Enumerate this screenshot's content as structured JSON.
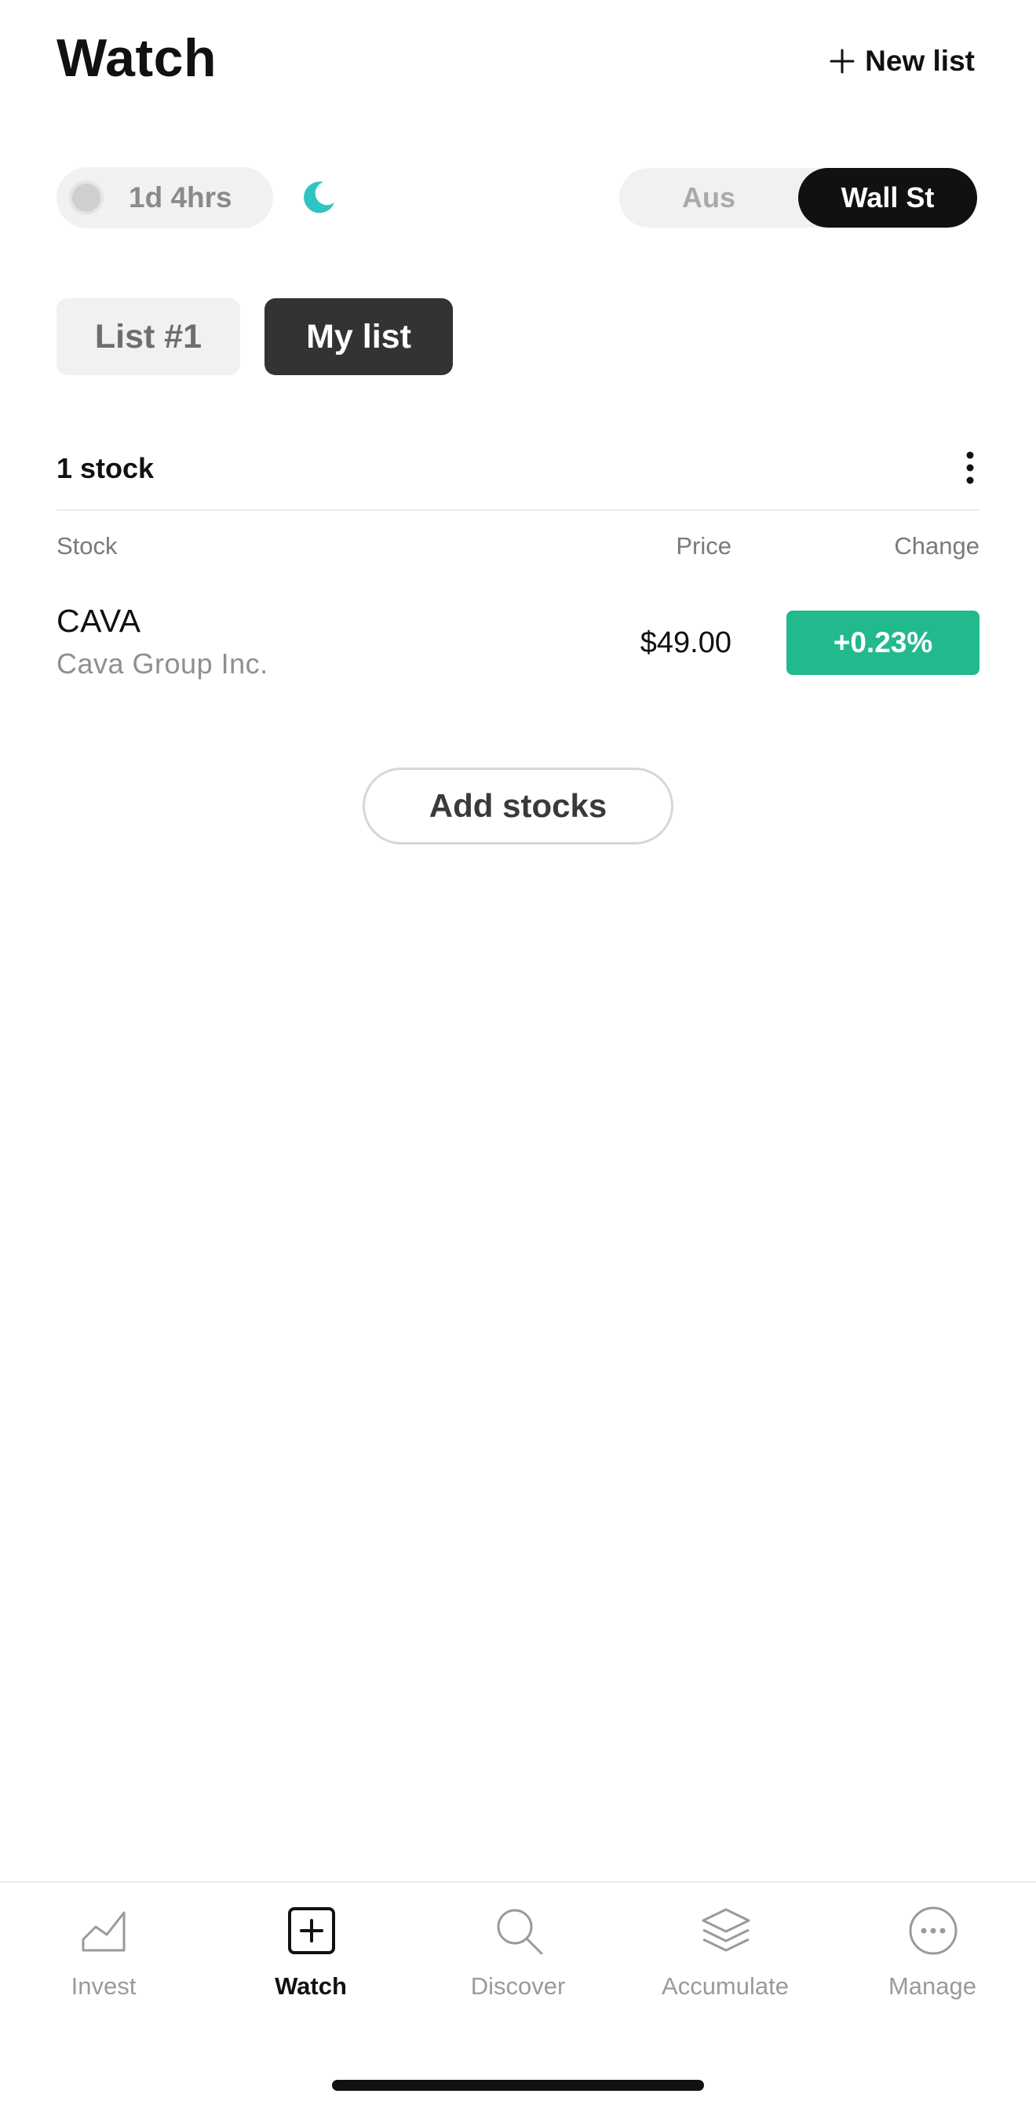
{
  "header": {
    "title": "Watch",
    "new_list_label": "New list"
  },
  "market_status": {
    "countdown": "1d 4hrs",
    "night_icon": "moon-icon",
    "moon_color": "#2fc4c4"
  },
  "market_toggle": {
    "options": [
      "Aus",
      "Wall St"
    ],
    "selected": "Wall St"
  },
  "lists": {
    "tabs": [
      "List #1",
      "My list"
    ],
    "selected": "My list"
  },
  "watchlist": {
    "count_label": "1 stock",
    "columns": {
      "stock": "Stock",
      "price": "Price",
      "change": "Change"
    },
    "rows": [
      {
        "ticker": "CAVA",
        "company": "Cava Group Inc.",
        "price": "$49.00",
        "change": "+0.23%",
        "change_color": "#22b98e"
      }
    ],
    "add_button_label": "Add stocks"
  },
  "bottom_nav": {
    "items": [
      {
        "label": "Invest",
        "icon": "chart-icon"
      },
      {
        "label": "Watch",
        "icon": "plus-square-icon"
      },
      {
        "label": "Discover",
        "icon": "search-icon"
      },
      {
        "label": "Accumulate",
        "icon": "layers-icon"
      },
      {
        "label": "Manage",
        "icon": "more-circle-icon"
      }
    ],
    "active": "Watch"
  }
}
